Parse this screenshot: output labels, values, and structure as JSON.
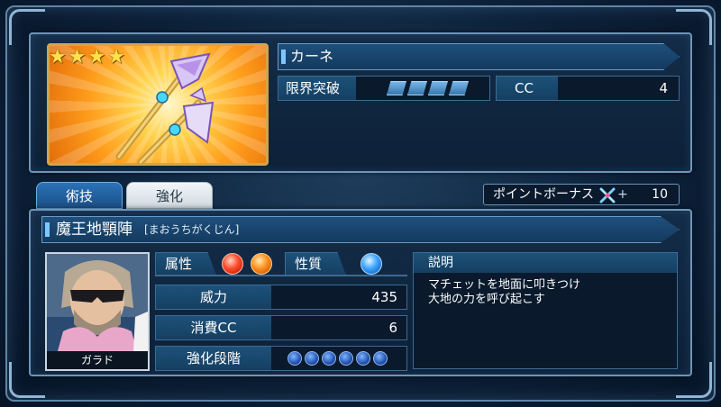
{
  "weapon": {
    "name": "カーネ",
    "rarity_stars": 4,
    "limit_break_label": "限界突破",
    "limit_break_level": 4,
    "cc_label": "CC",
    "cc_value": "4"
  },
  "tabs": [
    {
      "label": "術技",
      "active": true
    },
    {
      "label": "強化",
      "active": false
    }
  ],
  "bonus": {
    "label": "ポイントボーナス",
    "plus": "+",
    "value": "10"
  },
  "skill": {
    "name": "魔王地顎陣",
    "reading": "[まおうちがくじん]",
    "character_name": "ガラド",
    "attribute_label": "属性",
    "attributes": [
      "fire-element-icon",
      "flame-element-icon"
    ],
    "nature_label": "性質",
    "nature_icon": "water-element-icon",
    "power_label": "威力",
    "power_value": "435",
    "cc_cost_label": "消費CC",
    "cc_cost_value": "6",
    "enhance_label": "強化段階",
    "enhance_stages": 6,
    "description_label": "説明",
    "description_lines": [
      "マチェットを地面に叩きつけ",
      "大地の力を呼び起こす"
    ]
  },
  "colors": {
    "accent_blue": "#1d5179",
    "frame": "#6e95b8",
    "gold_border": "#d2a64a",
    "star": "#ffe14a"
  }
}
